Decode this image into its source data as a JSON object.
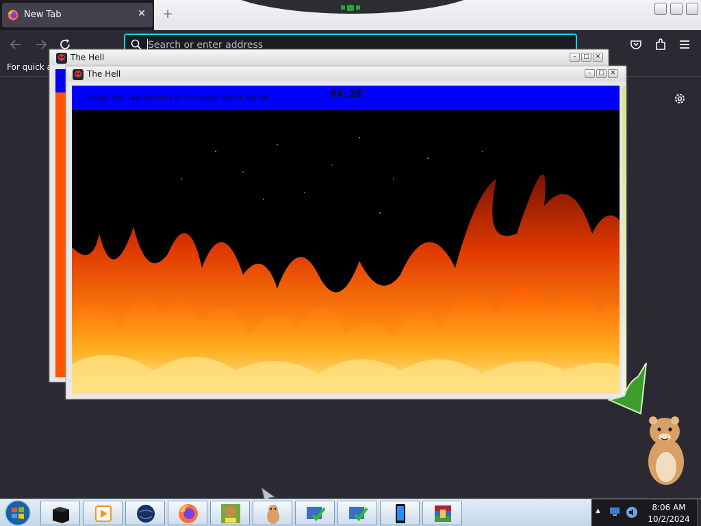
{
  "browser": {
    "tab_title": "New Tab",
    "tab_close_icon": "close-icon",
    "new_tab_icon": "plus-icon",
    "url_placeholder": "Search or enter address",
    "bookmarks_hint": "For quick ac",
    "accent_color": "#00ddff"
  },
  "windows": {
    "back": {
      "title": "The Hell"
    },
    "front": {
      "title": "The Hell",
      "message": "Enjoy Your Last Minutes In Computer HA HA HA HA",
      "timer": "04:28"
    }
  },
  "colors": {
    "banner_blue": "#0000ff",
    "fire_orange": "#ff5500"
  },
  "taskbar": {
    "start_icon": "windows-start-icon",
    "apps": [
      {
        "name": "black-box-app"
      },
      {
        "name": "media-player-app"
      },
      {
        "name": "globe-app"
      },
      {
        "name": "firefox-app"
      },
      {
        "name": "box-game-app"
      },
      {
        "name": "hamster-app"
      },
      {
        "name": "installer-check-app-1"
      },
      {
        "name": "installer-check-app-2"
      },
      {
        "name": "phone-app"
      },
      {
        "name": "winrar-app"
      }
    ],
    "clock": {
      "time": "8:06 AM",
      "date": "10/2/2024"
    }
  }
}
